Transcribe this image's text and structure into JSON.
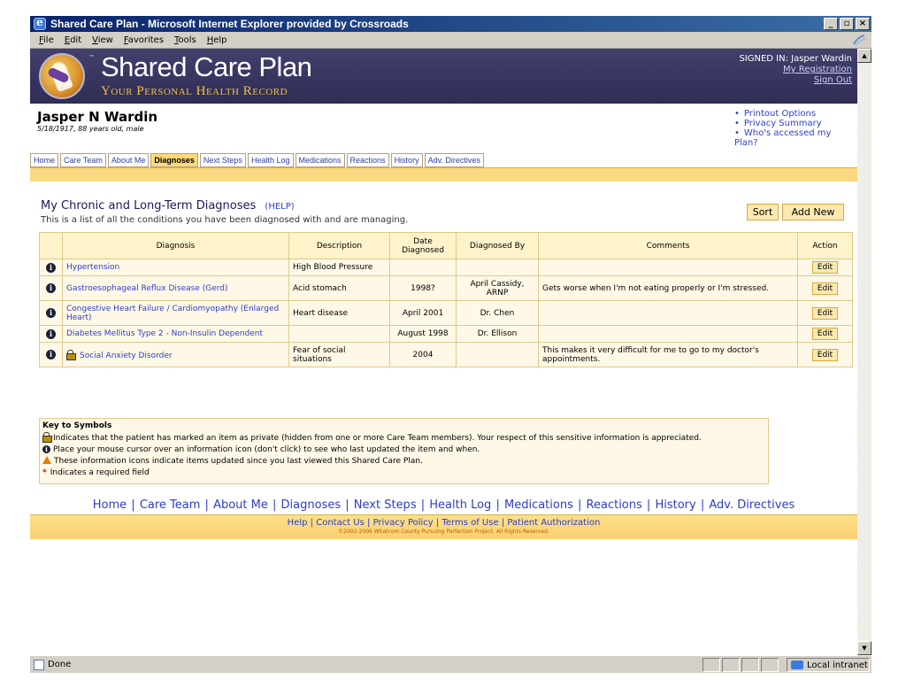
{
  "window": {
    "title": "Shared Care Plan - Microsoft Internet Explorer provided by Crossroads",
    "menu": [
      "File",
      "Edit",
      "View",
      "Favorites",
      "Tools",
      "Help"
    ],
    "status_text": "Done",
    "zone": "Local intranet"
  },
  "header": {
    "brand": "Shared Care Plan",
    "tagline": "Your Personal Health Record",
    "signed_in": "SIGNED IN: Jasper Wardin",
    "my_registration": "My Registration",
    "sign_out": "Sign Out"
  },
  "patient": {
    "name": "Jasper N Wardin",
    "info": "5/18/1917, 88 years old, male"
  },
  "top_links": [
    "Printout Options",
    "Privacy Summary",
    "Who's accessed my Plan?"
  ],
  "tabs": [
    {
      "label": "Home"
    },
    {
      "label": "Care Team"
    },
    {
      "label": "About Me"
    },
    {
      "label": "Diagnoses",
      "active": true
    },
    {
      "label": "Next Steps"
    },
    {
      "label": "Health Log"
    },
    {
      "label": "Medications"
    },
    {
      "label": "Reactions"
    },
    {
      "label": "History"
    },
    {
      "label": "Adv. Directives"
    }
  ],
  "section": {
    "title": "My Chronic and Long-Term Diagnoses",
    "help": "(HELP)",
    "subtitle": "This is a list of all the conditions you have been diagnosed with and are managing.",
    "sort": "Sort",
    "add_new": "Add New"
  },
  "table": {
    "headers": [
      "Diagnosis",
      "Description",
      "Date Diagnosed",
      "Diagnosed By",
      "Comments",
      "Action"
    ],
    "rows": [
      {
        "diagnosis": "Hypertension",
        "description": "High Blood Pressure",
        "date": "",
        "by": "",
        "comments": "",
        "action": "Edit",
        "private": false
      },
      {
        "diagnosis": "Gastroesophageal Reflux Disease (Gerd)",
        "description": "Acid stomach",
        "date": "1998?",
        "by": "April Cassidy, ARNP",
        "comments": "Gets worse when I'm not eating properly or I'm stressed.",
        "action": "Edit",
        "private": false
      },
      {
        "diagnosis": "Congestive Heart Failure / Cardiomyopathy (Enlarged Heart)",
        "description": "Heart disease",
        "date": "April 2001",
        "by": "Dr. Chen",
        "comments": "",
        "action": "Edit",
        "private": false
      },
      {
        "diagnosis": "Diabetes Mellitus Type 2 - Non-Insulin Dependent",
        "description": "",
        "date": "August 1998",
        "by": "Dr. Ellison",
        "comments": "",
        "action": "Edit",
        "private": false
      },
      {
        "diagnosis": "Social Anxiety Disorder",
        "description": "Fear of social situations",
        "date": "2004",
        "by": "",
        "comments": "This makes it very difficult for me to go to my doctor's appointments.",
        "action": "Edit",
        "private": true
      }
    ]
  },
  "key": {
    "title": "Key to Symbols",
    "private": "Indicates that the patient has marked an item as private (hidden from one or more Care Team members). Your respect of this sensitive information is appreciated.",
    "info": "Place your mouse cursor over an information icon (don't click) to see who last updated the item and when.",
    "updated": "These information icons indicate items updated since you last viewed this Shared Care Plan.",
    "required_symbol": "*",
    "required": "Indicates a required field"
  },
  "bottom_nav": [
    "Home",
    "Care Team",
    "About Me",
    "Diagnoses",
    "Next Steps",
    "Health Log",
    "Medications",
    "Reactions",
    "History",
    "Adv. Directives"
  ],
  "footer": {
    "links": [
      "Help",
      "Contact Us",
      "Privacy Policy",
      "Terms of Use",
      "Patient Authorization"
    ],
    "copyright": "©2002-2006 Whatcom County Pursuing Perfection Project. All Rights Reserved."
  },
  "icons": {
    "window_icon": "ie-icon",
    "info": "info-icon",
    "lock": "lock-icon",
    "warning": "warning-icon"
  },
  "colors": {
    "header_bg": "#43406d",
    "tab_band": "#fad982",
    "link": "#2b3ec8"
  }
}
